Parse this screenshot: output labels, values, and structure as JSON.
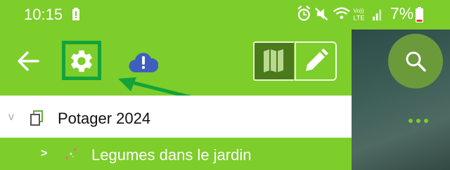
{
  "statusbar": {
    "time": "10:15",
    "network_label_top": "Vo))",
    "network_label_bottom": "LTE",
    "battery_percent": "7%"
  },
  "toolbar": {
    "icons": [
      "back-arrow-icon",
      "gear-icon",
      "cloud-alert-icon",
      "map-icon",
      "pencil-icon"
    ]
  },
  "tree": {
    "items": [
      {
        "label": "Potager 2024",
        "expander": "v"
      },
      {
        "label": "Legumes dans le jardin",
        "expander": ">"
      }
    ]
  },
  "colors": {
    "accent_green": "#7dcd2b",
    "highlight_green": "#14a33a",
    "map_button_bg": "#4a7a1c"
  }
}
